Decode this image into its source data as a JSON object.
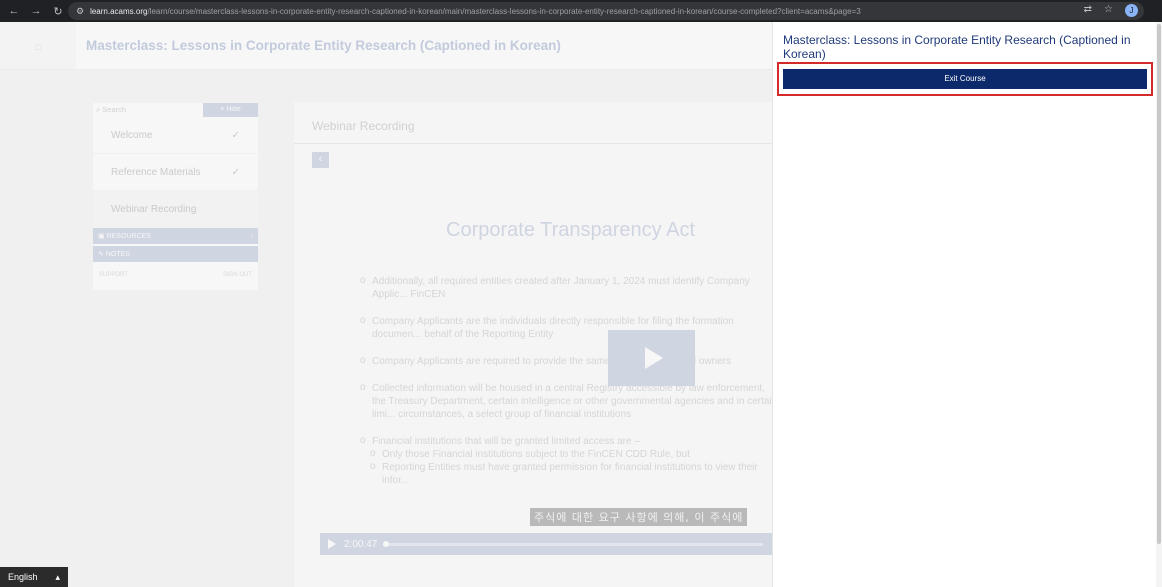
{
  "browser": {
    "url_domain": "learn.acams.org",
    "url_path": "/learn/course/masterclass-lessons-in-corporate-entity-research-captioned-in-korean/main/masterclass-lessons-in-corporate-entity-research-captioned-in-korean/course-completed?client=acams&page=3",
    "profile_initial": "J"
  },
  "header": {
    "course_title": "Masterclass: Lessons in Corporate Entity Research (Captioned in Korean)"
  },
  "sidebar": {
    "search_placeholder": "Search",
    "hide_label": "× Hide",
    "items": [
      {
        "label": "Welcome",
        "check": "✓"
      },
      {
        "label": "Reference Materials",
        "check": "✓"
      },
      {
        "label": "Webinar Recording",
        "check": ""
      }
    ],
    "resources_label": "RESOURCES",
    "notes_label": "NOTES",
    "support_label": "SUPPORT",
    "signout_label": "SIGN OUT"
  },
  "content": {
    "title": "Webinar Recording",
    "slide_title": "Corporate Transparency Act",
    "bullets": [
      "Additionally, all required entities created after January 1, 2024 must identify Company Applic... FinCEN",
      "Company Applicants are the individuals directly responsible for filing the formation documen... behalf of the Reporting Entity",
      "Company Applicants are required to provide the same ... ion as beneficial owners",
      "Collected information will be housed in a central Registry accessible by law enforcement, the Treasury Department, certain intelligence or other governmental agencies and in certain limi... circumstances, a select group of financial institutions",
      "Financial institutions that will be granted limited access are –"
    ],
    "sub_bullets": [
      "Only those Financial institutions subject to the FinCEN CDD Rule, but",
      "Reporting Entities must have granted permission for financial institutions to view their infor..."
    ],
    "caption": "주식에 대한 요구 사항에 의해, 이 주식에",
    "timestamp": "2:00:47"
  },
  "panel": {
    "title": "Masterclass: Lessons in Corporate Entity Research (Captioned in Korean)",
    "exit_label": "Exit Course"
  },
  "footer": {
    "language": "English"
  }
}
